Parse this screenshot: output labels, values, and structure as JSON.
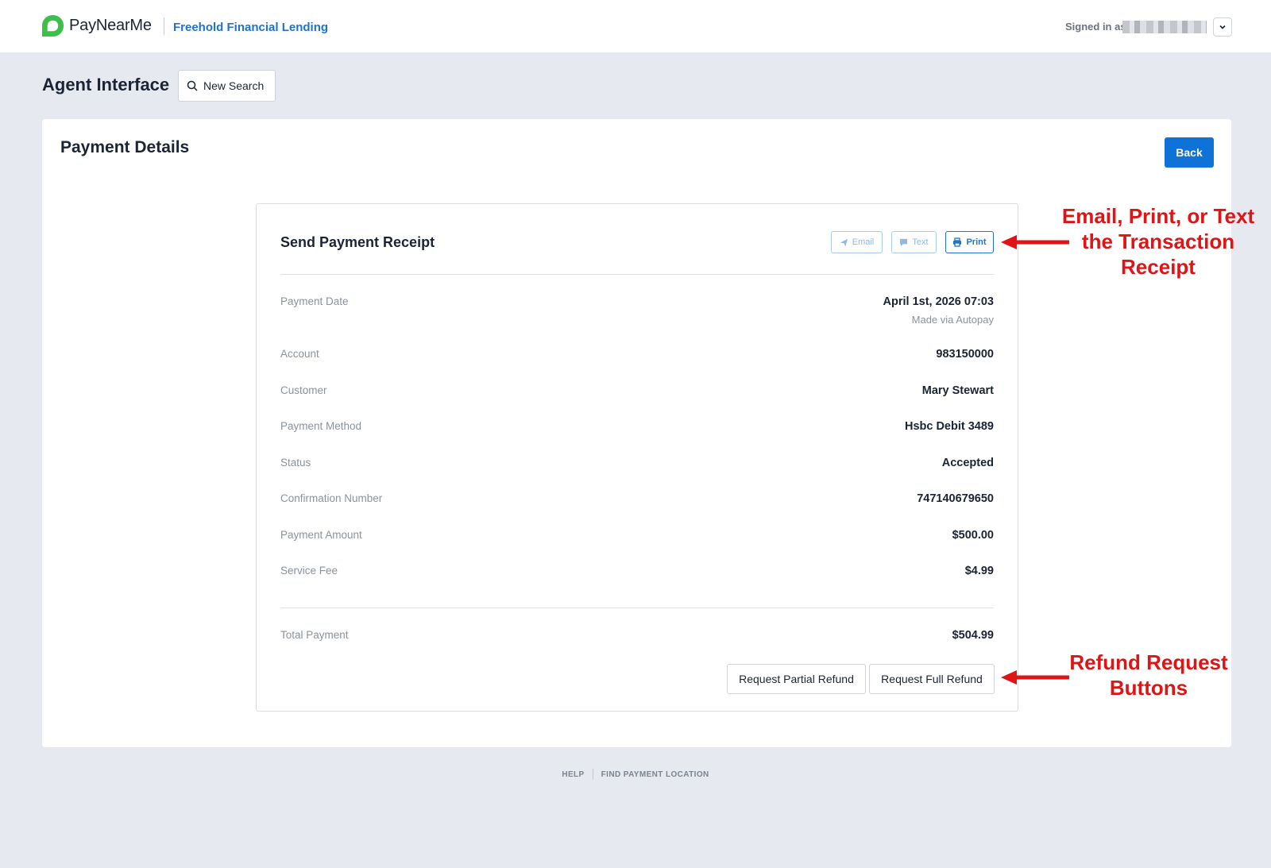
{
  "header": {
    "brand": "PayNearMe",
    "org_name": "Freehold Financial Lending",
    "signed_in_label": "Signed in as"
  },
  "page": {
    "title": "Agent Interface",
    "new_search_label": "New Search"
  },
  "panel": {
    "title": "Payment Details",
    "back_label": "Back"
  },
  "receipt": {
    "title": "Send Payment Receipt",
    "email_label": "Email",
    "text_label": "Text",
    "print_label": "Print",
    "rows": [
      {
        "label": "Payment Date",
        "value": "April 1st, 2026 07:03",
        "sub": "Made via Autopay"
      },
      {
        "label": "Account",
        "value": "983150000"
      },
      {
        "label": "Customer",
        "value": "Mary Stewart"
      },
      {
        "label": "Payment Method",
        "value": "Hsbc Debit 3489"
      },
      {
        "label": "Status",
        "value": "Accepted"
      },
      {
        "label": "Confirmation Number",
        "value": "747140679650"
      },
      {
        "label": "Payment Amount",
        "value": "$500.00"
      },
      {
        "label": "Service Fee",
        "value": "$4.99"
      }
    ],
    "total_label": "Total Payment",
    "total_value": "$504.99",
    "partial_refund_label": "Request Partial Refund",
    "full_refund_label": "Request Full Refund"
  },
  "footer": {
    "help": "HELP",
    "find_location": "FIND PAYMENT LOCATION"
  },
  "annotations": {
    "receipt_actions": "Email, Print, or Text the Transaction Receipt",
    "refund_buttons": "Refund Request Buttons"
  },
  "colors": {
    "brand_green": "#3dbf4a",
    "primary_blue": "#0e72d9",
    "annotation_red": "#e01414"
  }
}
